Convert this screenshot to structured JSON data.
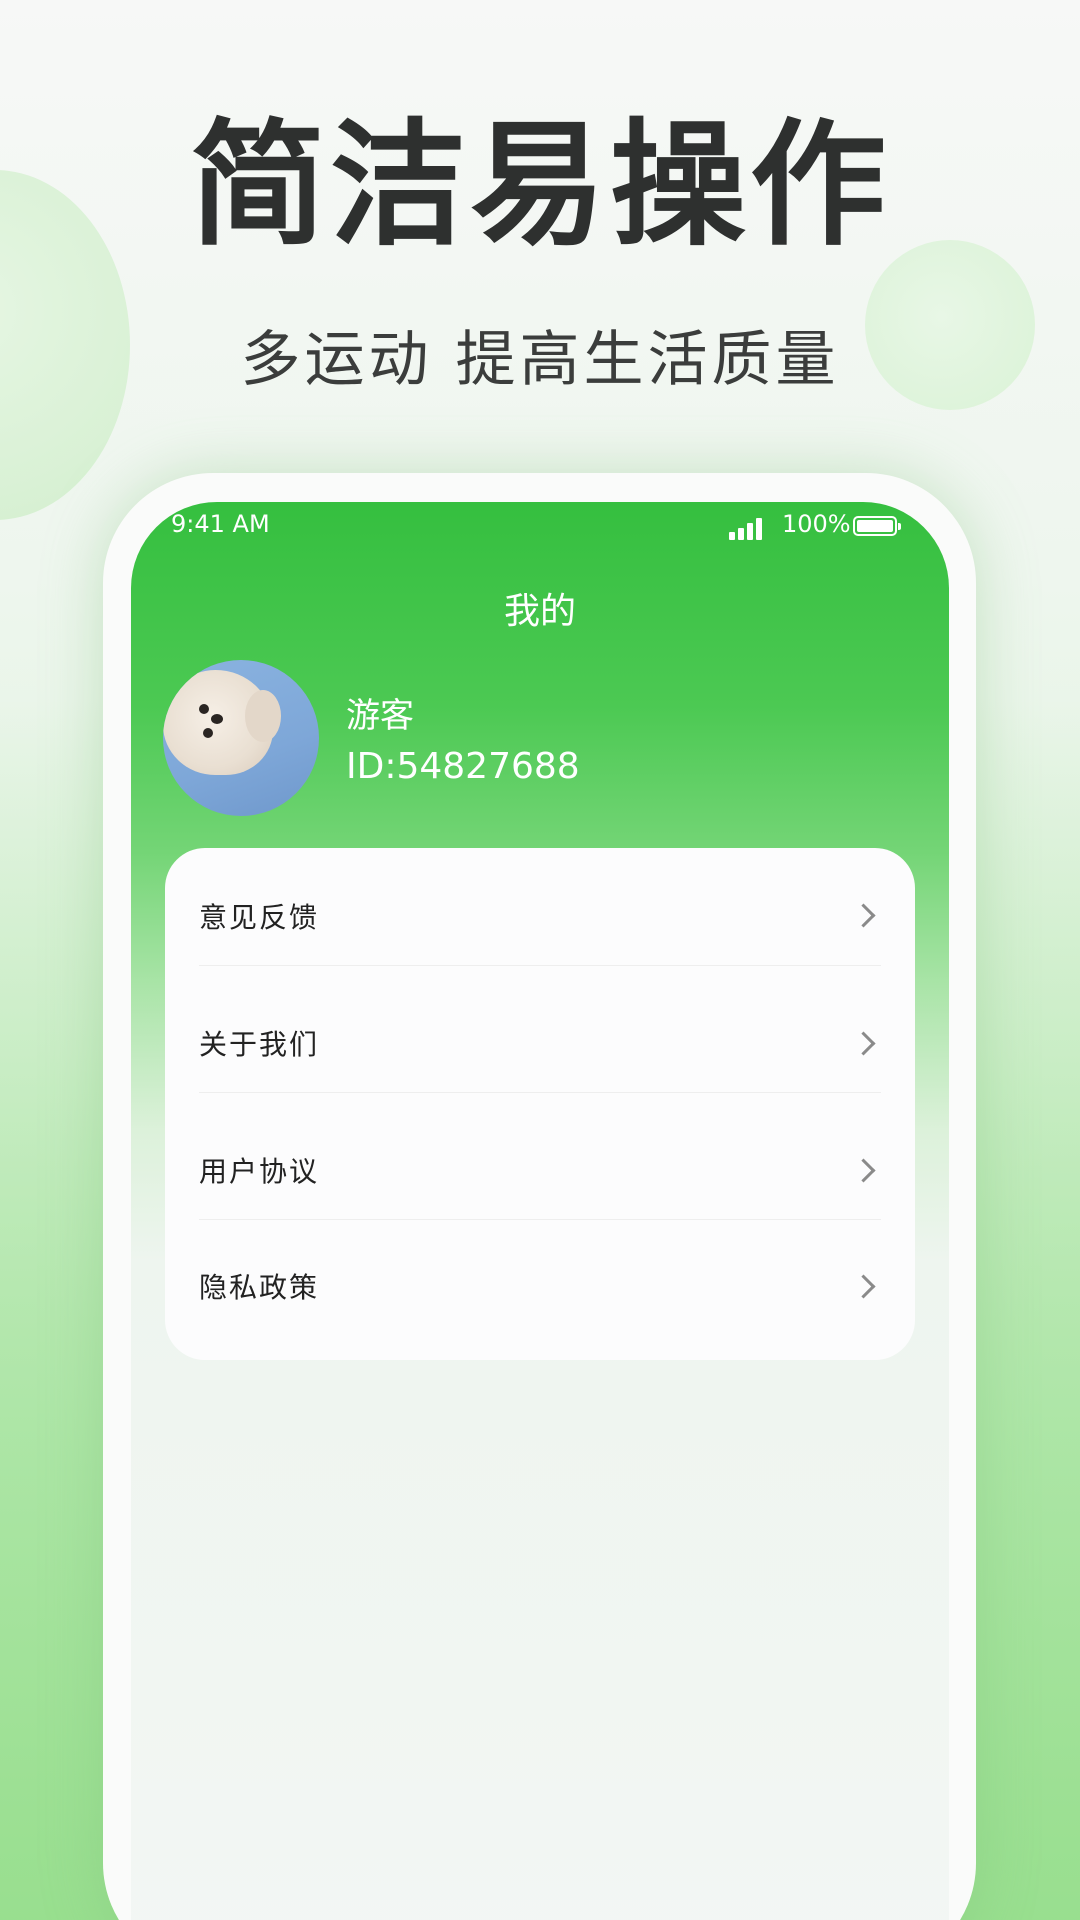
{
  "promo": {
    "headline": "简洁易操作",
    "subline": "多运动 提高生活质量"
  },
  "status_bar": {
    "time": "9:41 AM",
    "battery_percent": "100%",
    "signal_icon": "signal-bars-icon",
    "battery_icon": "battery-full-icon"
  },
  "header": {
    "title": "我的"
  },
  "profile": {
    "name": "游客",
    "id_text": "ID:54827688",
    "avatar_icon": "dog-avatar"
  },
  "menu": {
    "items": [
      {
        "label": "意见反馈",
        "icon": "chevron-right-icon"
      },
      {
        "label": "关于我们",
        "icon": "chevron-right-icon"
      },
      {
        "label": "用户协议",
        "icon": "chevron-right-icon"
      },
      {
        "label": "隐私政策",
        "icon": "chevron-right-icon"
      }
    ]
  },
  "colors": {
    "accent_green": "#35bf3f",
    "headline_text": "#2e302f",
    "menu_text": "#222222"
  }
}
